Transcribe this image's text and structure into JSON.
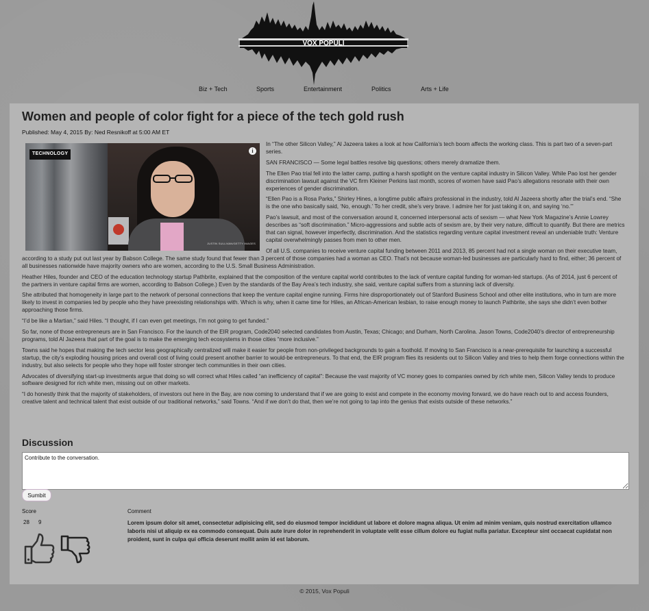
{
  "site": {
    "name": "VOX POPULI",
    "footer": "© 2015, Vox Populi"
  },
  "nav": {
    "items": [
      {
        "label": "Biz + Tech"
      },
      {
        "label": "Sports"
      },
      {
        "label": "Entertainment"
      },
      {
        "label": "Politics"
      },
      {
        "label": "Arts + Life"
      }
    ]
  },
  "article": {
    "title": "Women and people of color fight for a piece of the tech gold rush",
    "byline": "Published: May 4, 2015 By: Ned Resnikoff at 5:00 AM ET",
    "image": {
      "tag": "TECHNOLOGY",
      "info_icon": "i",
      "credit": "JUSTIN SULLIVAN/GETTY IMAGES"
    },
    "paragraphs": [
      "In “The other Silicon Valley,” Al Jazeera takes a look at how California’s tech boom affects the working class. This is part two of a seven-part series.",
      "SAN FRANCISCO — Some legal battles resolve big questions; others merely dramatize them.",
      "The Ellen Pao trial fell into the latter camp, putting a harsh spotlight on the venture capital industry in Silicon Valley. While Pao lost her gender discrimination lawsuit against the VC firm Kleiner Perkins last month, scores of women have said Pao’s allegations resonate with their own experiences of gender discrimination.",
      "“Ellen Pao is a Rosa Parks,” Shirley Hines, a longtime public affairs professional in the industry, told Al Jazeera shortly after the trial’s end. “She is the one who basically said, ‘No, enough.’ To her credit, she’s very brave. I admire her for just taking it on, and saying ‘no.’”",
      "Pao’s lawsuit, and most of the conversation around it, concerned interpersonal acts of sexism — what New York Magazine’s Annie Lowrey describes as “soft discrimination.” Micro-aggressions and subtle acts of sexism are, by their very nature, difficult to quantify. But there are metrics that can signal, however imperfectly, discrimination. And the statistics regarding venture capital investment reveal an undeniable truth: Venture capital overwhelmingly passes from men to other men.",
      "Of all U.S. companies to receive venture capital funding between 2011 and 2013, 85 percent had not a single woman on their executive team, according to a study put out last year by Babson College. The same study found that fewer than 3 percent of those companies had a woman as CEO. That’s not because woman-led businesses are particularly hard to find, either; 36 percent of all businesses nationwide have majority owners who are women, according to the U.S. Small Business Administration.",
      "Heather Hiles, founder and CEO of the education technology startup Pathbrite, explained that the composition of the venture capital world contributes to the lack of venture capital funding for woman-led startups. (As of 2014, just 6 percent of the partners in venture capital firms are women, according to Babson College.) Even by the standards of the Bay Area’s tech industry, she said, venture capital suffers from a stunning lack of diversity.",
      "She attributed that homogeneity in large part to the network of personal connections that keep the venture capital engine running. Firms hire disproportionately out of Stanford Business School and other elite institutions, who in turn are more likely to invest in companies led by people who they have preexisting relationships with. Which is why, when it came time for Hiles, an African-American lesbian, to raise enough money to launch Pathbrite, she says she didn’t even bother approaching those firms.",
      "“I’d be like a Martian,” said Hiles. “I thought, if I can even get meetings, I’m not going to get funded.”",
      "So far, none of those entrepreneurs are in San Francisco. For the launch of the EIR program, Code2040 selected candidates from Austin, Texas; Chicago; and Durham, North Carolina. Jason Towns, Code2040’s director of entrepreneurship programs, told Al Jazeera that part of the goal is to make the emerging tech ecosystems in those cities “more inclusive.”",
      "Towns said he hopes that making the tech sector less geographically centralized will make it easier for people from non-privileged backgrounds to gain a foothold. If moving to San Francisco is a near-prerequisite for launching a successful startup, the city’s exploding housing prices and overall cost of living could present another barrier to would-be entrepreneurs. To that end, the EIR program flies its residents out to Silicon Valley and tries to help them forge connections within the industry, but also selects for people who they hope will foster stronger tech communities in their own cities.",
      "Advocates of diversifying start-up investments argue that doing so will correct what Hiles called “an inefficiency of capital”: Because the vast majority of VC money goes to companies owned by rich white men, Silicon Valley tends to produce software designed for rich white men, missing out on other markets.",
      "“I do honestly think that the majority of stakeholders, of investors out here in the Bay, are now coming to understand that if we are going to exist and compete in the economy moving forward, we do have reach out to and access founders, creative talent and technical talent that exist outside of our traditional networks,” said Towns. “And if we don’t do that, then we’re not going to tap into the genius that exists outside of these networks.”"
    ]
  },
  "discussion": {
    "title": "Discussion",
    "input_value": "Contribute to the conversation.",
    "submit_label": "Sumbit",
    "score_header": "Score",
    "comment_header": "Comment",
    "comments": [
      {
        "upvotes": "28",
        "downvotes": "9",
        "text": "Lorem ipsum dolor sit amet, consectetur adipisicing elit, sed do eiusmod tempor incididunt ut labore et dolore magna aliqua. Ut enim ad minim veniam, quis nostrud exercitation ullamco laboris nisi ut aliquip ex ea commodo consequat. Duis aute irure dolor in reprehenderit in voluptate velit esse cillum dolore eu fugiat nulla pariatur. Excepteur sint occaecat cupidatat non proident, sunt in culpa qui officia deserunt mollit anim id est laborum."
      }
    ]
  },
  "icons": {
    "logo": "sound-wave-logo",
    "upvote": "thumbs-up-icon",
    "downvote": "thumbs-down-icon",
    "info": "info-icon"
  }
}
